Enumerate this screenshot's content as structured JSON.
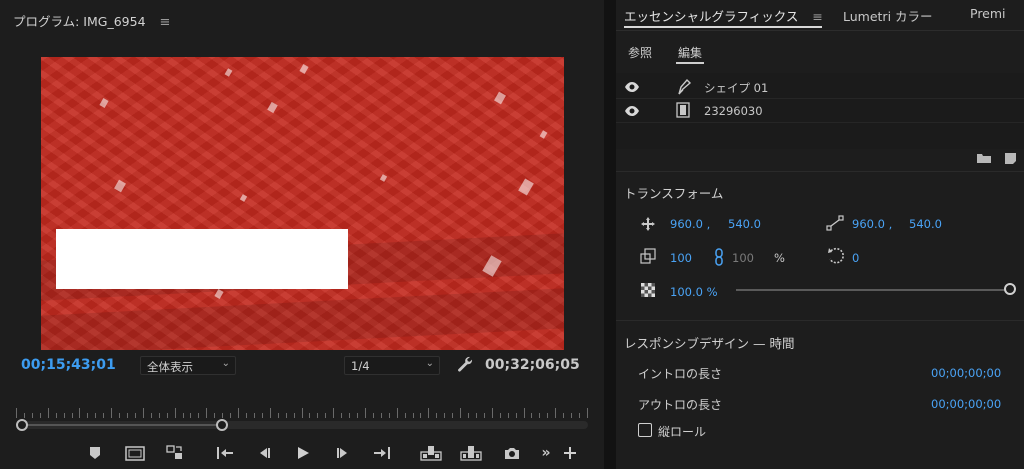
{
  "program_monitor": {
    "title": "プログラム: IMG_6954",
    "menu_icon": "hamburger-icon",
    "current_timecode": "00;15;43;01",
    "fit_dropdown": "全体表示",
    "resolution_dropdown": "1/4",
    "total_duration": "00;32;06;05",
    "transport_icons": [
      "marker-icon",
      "safe-margins-icon",
      "lift-icon",
      "go-to-in-icon",
      "step-back-icon",
      "play-icon",
      "step-forward-icon",
      "go-to-out-icon",
      "insert-icon",
      "overwrite-icon",
      "export-frame-icon",
      "more-icon",
      "add-icon"
    ]
  },
  "panel_tabs": [
    "エッセンシャルグラフィックス",
    "Lumetri カラー",
    "Premi"
  ],
  "essential_graphics": {
    "subtabs": [
      "参照",
      "編集"
    ],
    "layers": [
      {
        "name": "シェイプ 01",
        "type_icon": "pen-icon",
        "visible": true
      },
      {
        "name": "23296030",
        "type_icon": "film-icon",
        "visible": true
      }
    ],
    "transform": {
      "title": "トランスフォーム",
      "position_x": "960.0 ,",
      "position_y": "540.0",
      "anchor_x": "960.0 ,",
      "anchor_y": "540.0",
      "scale": "100",
      "scale_linked": "100",
      "scale_unit": "%",
      "rotation": "0",
      "opacity": "100.0 %"
    },
    "responsive_design": {
      "title": "レスポンシブデザイン — 時間",
      "intro_label": "イントロの長さ",
      "intro_value": "00;00;00;00",
      "outro_label": "アウトロの長さ",
      "outro_value": "00;00;00;00",
      "roll_label": "縦ロール",
      "roll_checked": false
    }
  },
  "colors": {
    "accent_blue": "#4aa3f5",
    "video_red": "#c42a1f"
  }
}
